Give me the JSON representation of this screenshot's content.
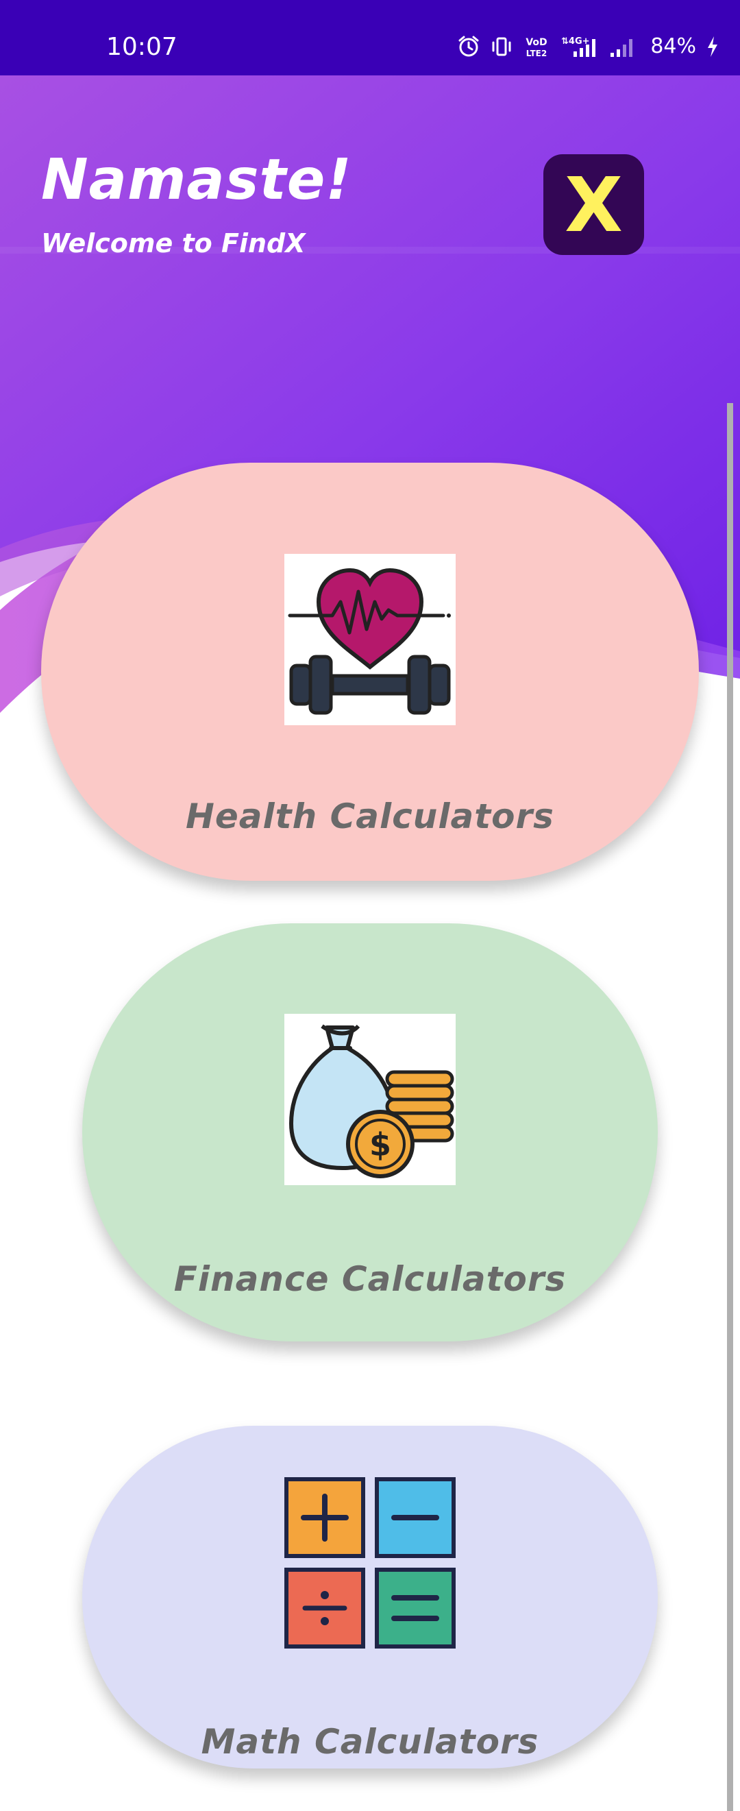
{
  "status_bar": {
    "time": "10:07",
    "battery": "84%",
    "icons": [
      "alarm-icon",
      "vibrate-icon",
      "volte-icon",
      "signal-4g-icon",
      "signal-icon",
      "charging-icon"
    ],
    "volte_text": "VoD LTE2",
    "network_text": "4G+"
  },
  "header": {
    "title": "Namaste!",
    "subtitle": "Welcome to FindX",
    "logo_letter": "X",
    "gradient_colors": [
      "#a64de6",
      "#7a2ee8",
      "#6a1fe0"
    ]
  },
  "cards": [
    {
      "label": "Health Calculators",
      "icon": "heart-dumbbell-icon",
      "color": "#fbc9c7"
    },
    {
      "label": "Finance Calculators",
      "icon": "money-bag-coins-icon",
      "color": "#c8e6cb"
    },
    {
      "label": "Math Calculators",
      "icon": "math-operators-icon",
      "color": "#dcddf7"
    }
  ]
}
